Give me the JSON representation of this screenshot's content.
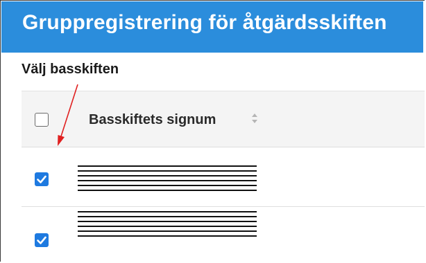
{
  "window": {
    "title": "Gruppregistrering för åtgärdsskiften"
  },
  "section": {
    "label": "Välj basskiften"
  },
  "table": {
    "columns": [
      {
        "label": "Basskiftets signum",
        "sortable": true
      }
    ],
    "header_checkbox_checked": false,
    "rows": [
      {
        "checked": true,
        "signum": ""
      },
      {
        "checked": true,
        "signum": ""
      }
    ]
  },
  "icons": {
    "sort": "sort-icon",
    "checkmark": "checkmark-icon"
  },
  "colors": {
    "title_bar": "#2b8ddc",
    "checkbox_checked": "#1e7ae0",
    "annotation_arrow": "#e02020"
  }
}
